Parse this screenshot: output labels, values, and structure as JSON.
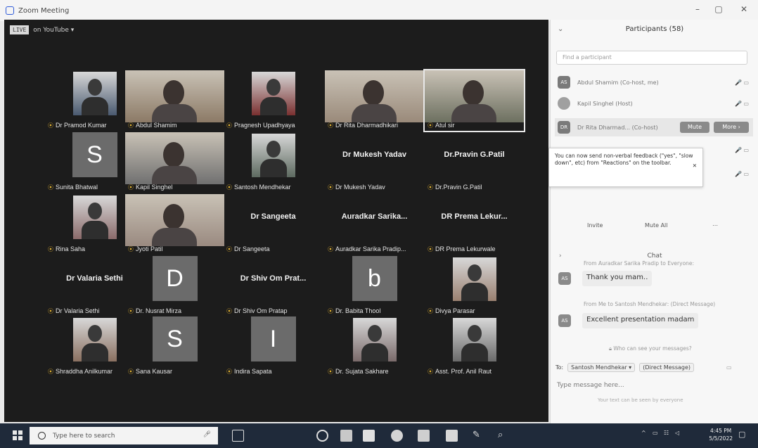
{
  "window": {
    "title": "Zoom Meeting"
  },
  "live": {
    "badge": "LIVE",
    "text": "on YouTube ▾"
  },
  "tiles": [
    {
      "name": "Dr Pramod Kumar",
      "kind": "photo",
      "color": "#4a5a70"
    },
    {
      "name": "Abdul Shamim",
      "kind": "video",
      "color": "#8c7a66"
    },
    {
      "name": "Pragnesh Upadhyaya",
      "kind": "photo",
      "color": "#7a3030"
    },
    {
      "name": "Dr Rita Dharmadhikari",
      "kind": "video",
      "color": "#9a8a7a"
    },
    {
      "name": "Atul sir",
      "kind": "video",
      "color": "#6d7060"
    },
    {
      "name": "Sunita Bhatwal",
      "kind": "letter",
      "letter": "S",
      "color": "#6b6b6b"
    },
    {
      "name": "Kapil Singhel",
      "kind": "video",
      "color": "#707070"
    },
    {
      "name": "Santosh Mendhekar",
      "kind": "photo",
      "color": "#5d6a60"
    },
    {
      "name": "Dr Mukesh Yadav",
      "kind": "name",
      "big": "Dr Mukesh Yadav"
    },
    {
      "name": "Dr.Pravin G.Patil",
      "kind": "name",
      "big": "Dr.Pravin G.Patil"
    },
    {
      "name": "Rina Saha",
      "kind": "photo",
      "color": "#8a6a6a"
    },
    {
      "name": "Jyoti Patil",
      "kind": "video",
      "color": "#9a8a80"
    },
    {
      "name": "Dr Sangeeta",
      "kind": "name",
      "big": "Dr Sangeeta"
    },
    {
      "name": "Auradkar Sarika Pradip...",
      "kind": "name",
      "big": "Auradkar Sarika..."
    },
    {
      "name": "DR Prema Lekurwale",
      "kind": "name",
      "big": "DR Prema Lekur..."
    },
    {
      "name": "Dr Valaria Sethi",
      "kind": "name",
      "big": "Dr Valaria Sethi"
    },
    {
      "name": "Dr. Nusrat Mirza",
      "kind": "letter",
      "letter": "D",
      "color": "#6b6b6b"
    },
    {
      "name": "Dr Shiv Om Pratap",
      "kind": "name",
      "big": "Dr Shiv Om Prat..."
    },
    {
      "name": "Dr. Babita Thool",
      "kind": "letter",
      "letter": "b",
      "color": "#6b6b6b"
    },
    {
      "name": "Divya Parasar",
      "kind": "photo",
      "color": "#9a8070"
    },
    {
      "name": "Shraddha Anilkumar",
      "kind": "photo",
      "color": "#8a7060"
    },
    {
      "name": "Sana Kausar",
      "kind": "letter",
      "letter": "S",
      "color": "#6b6b6b"
    },
    {
      "name": "Indira Sapata",
      "kind": "letter",
      "letter": "I",
      "color": "#6b6b6b"
    },
    {
      "name": "Dr. Sujata Sakhare",
      "kind": "photo",
      "color": "#7a6a6a"
    },
    {
      "name": "Asst. Prof. Anil Raut",
      "kind": "photo",
      "color": "#6a6a6a"
    }
  ],
  "panel": {
    "title": "Participants (58)",
    "search_placeholder": "Find a participant",
    "participants": [
      {
        "initials": "AS",
        "name": "Abdul Shamim (Co-host, me)",
        "icons": "🎤 ▭"
      },
      {
        "initials": "",
        "name": "Kapil Singhel (Host)",
        "icons": "🎤 ▭"
      },
      {
        "initials": "DR",
        "name": "Dr Rita Dharmad... (Co-host)",
        "icons": ""
      },
      {
        "initials": "",
        "name": "",
        "icons": "🎤 ▭"
      },
      {
        "initials": "",
        "name": "",
        "icons": "🎤 ▭"
      }
    ],
    "mute_label": "Mute",
    "more_label": "More ›",
    "tooltip": "You can now send non-verbal feedback (\"yes\", \"slow down\", etc) from \"Reactions\" on the toolbar.",
    "invite_label": "Invite",
    "mute_all_label": "Mute All"
  },
  "chat": {
    "title": "Chat",
    "messages": [
      {
        "from": "From Auradkar Sarika Pradip to Everyone:",
        "initials": "AS",
        "text": "Thank you mam.."
      },
      {
        "from": "From Me to Santosh Mendhekar: (Direct Message)",
        "initials": "AS",
        "text": "Excellent presentation madam"
      }
    ],
    "who_can_see": "Who can see your messages?",
    "to_label": "To:",
    "to_recipient": "Santosh Mendhekar ▾",
    "to_mode": "(Direct Message)",
    "placeholder": "Type message here...",
    "hint": "Your text can be seen by everyone"
  },
  "taskbar": {
    "search_placeholder": "Type here to search",
    "time": "4:45 PM",
    "date": "5/5/2022"
  }
}
